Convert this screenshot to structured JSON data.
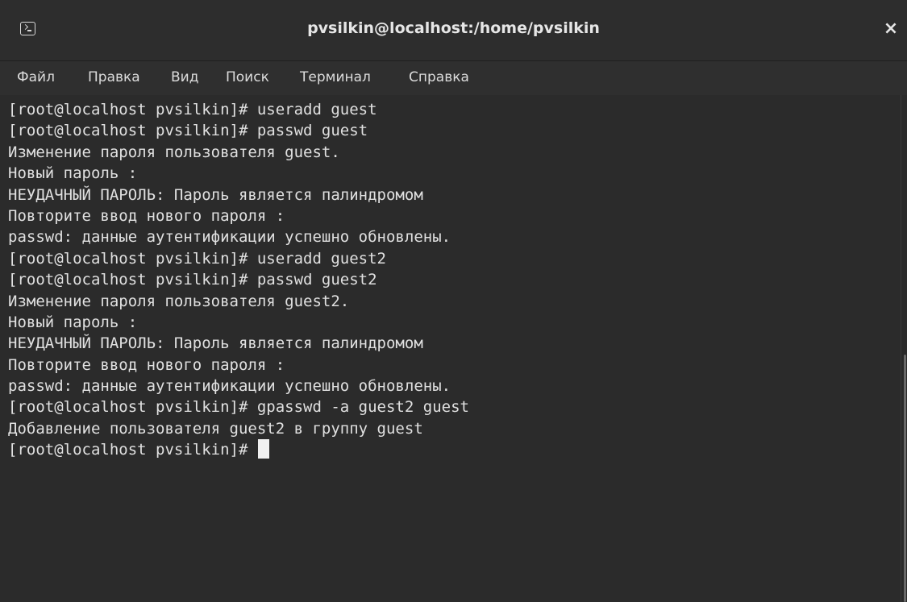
{
  "window": {
    "title": "pvsilkin@localhost:/home/pvsilkin",
    "app_icon": "terminal-icon",
    "close_icon": "close-icon",
    "close_glyph": "×"
  },
  "menu": {
    "items": [
      "Файл",
      "Правка",
      "Вид",
      "Поиск",
      "Терминал",
      "Справка"
    ]
  },
  "terminal": {
    "lines": [
      "[root@localhost pvsilkin]# useradd guest",
      "[root@localhost pvsilkin]# passwd guest",
      "Изменение пароля пользователя guest.",
      "Новый пароль :",
      "НЕУДАЧНЫЙ ПАРОЛЬ: Пароль является палиндромом",
      "Повторите ввод нового пароля :",
      "passwd: данные аутентификации успешно обновлены.",
      "[root@localhost pvsilkin]# useradd guest2",
      "[root@localhost pvsilkin]# passwd guest2",
      "Изменение пароля пользователя guest2.",
      "Новый пароль :",
      "НЕУДАЧНЫЙ ПАРОЛЬ: Пароль является палиндромом",
      "Повторите ввод нового пароля :",
      "passwd: данные аутентификации успешно обновлены.",
      "[root@localhost pvsilkin]# gpasswd -a guest2 guest",
      "Добавление пользователя guest2 в группу guest"
    ],
    "prompt": "[root@localhost pvsilkin]# "
  },
  "colors": {
    "background": "#2b2b2b",
    "text": "#e0e0e0",
    "titlebar": "#2d2d2d"
  }
}
